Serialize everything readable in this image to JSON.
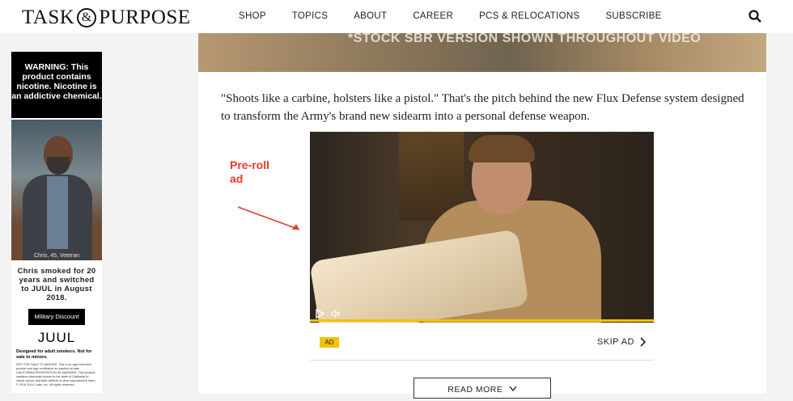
{
  "header": {
    "logo_left": "TASK",
    "logo_amp": "&",
    "logo_right": "PURPOSE",
    "nav": [
      "SHOP",
      "TOPICS",
      "ABOUT",
      "CAREER",
      "PCS & RELOCATIONS",
      "SUBSCRIBE"
    ],
    "search_icon": "search-icon"
  },
  "sidebar_ad": {
    "warning": "WARNING: This product contains nicotine. Nicotine is an addictive chemical.",
    "photo_caption": "Chris, 45, Veteran",
    "story": "Chris smoked for 20 years and switched to JUUL in August 2018.",
    "button": "Military Discount",
    "brand": "JUUL",
    "disclaimer": "Designed for adult smokers. Not for sale to minors.",
    "fine_print": "NOT FOR SALE TO MINORS. This is an age-restricted product and age verification is required at sale. CALIFORNIA PROPOSITION 65 WARNING: This product contains chemicals known to the state of California to cause cancer and birth defects or other reproductive harm. © 2019 JUUL Labs, Inc. All rights reserved."
  },
  "article": {
    "hero_caption": "*STOCK SBR VERSION SHOWN THROUGHOUT VIDEO",
    "paragraph": "\"Shoots like a carbine, holsters like a pistol.\" That's the pitch behind the new Flux Defense system designed to transform the Army's brand new sidearm into a personal defense weapon.",
    "ad_badge": "AD",
    "skip_ad": "SKIP AD",
    "read_more": "READ MORE",
    "progress": 1.0
  },
  "annotation": {
    "label": "Pre-roll ad",
    "color": "#e8392a"
  },
  "colors": {
    "accent": "#f3c200"
  }
}
